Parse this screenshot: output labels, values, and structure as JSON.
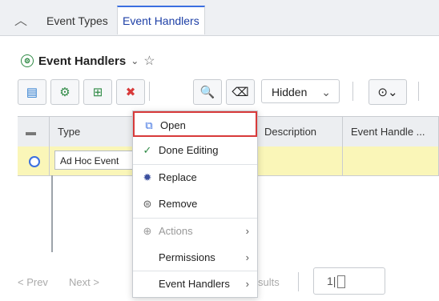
{
  "tabs": {
    "collapse_icon": "chevron-up-icon",
    "items": [
      "Event Types",
      "Event Handlers"
    ],
    "active": 1
  },
  "title": {
    "text": "Event Handlers"
  },
  "toolbar": {
    "select_value": "Hidden"
  },
  "grid": {
    "columns": [
      "Type",
      "Description",
      "Event Handle ..."
    ],
    "rows": [
      {
        "type": "Ad Hoc Event"
      }
    ]
  },
  "footer": {
    "prev": "< Prev",
    "next": "Next >",
    "results_suffix": "sults",
    "page_value": "1"
  },
  "menu": {
    "items": [
      {
        "label": "Open",
        "icon": "open-external-icon",
        "disabled": false,
        "submenu": false,
        "highlighted": true
      },
      {
        "label": "Done Editing",
        "icon": "check-icon",
        "disabled": false,
        "submenu": false
      },
      {
        "label": "Replace",
        "icon": "replace-icon",
        "disabled": false,
        "submenu": false
      },
      {
        "label": "Remove",
        "icon": "remove-icon",
        "disabled": false,
        "submenu": false
      },
      {
        "label": "Actions",
        "icon": "actions-icon",
        "disabled": true,
        "submenu": true
      },
      {
        "label": "Permissions",
        "icon": "",
        "disabled": false,
        "submenu": true
      },
      {
        "label": "Event Handlers",
        "icon": "",
        "disabled": false,
        "submenu": true
      }
    ]
  },
  "colors": {
    "accent": "#3b6fe0",
    "highlight_border": "#d83a3a",
    "selected_row": "#faf6b8"
  }
}
